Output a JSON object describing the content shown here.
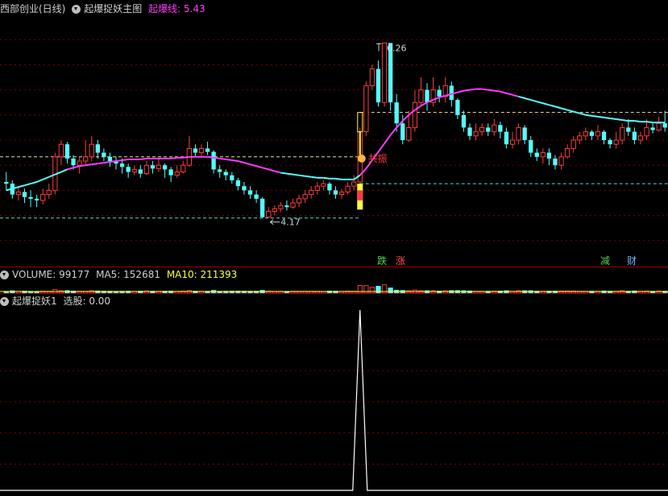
{
  "main": {
    "stock_label": "西部创业(日线)",
    "indicator_label": "起爆捉妖主图",
    "line_label": "起爆线: 5.43",
    "high_label": "6.26",
    "low_label": "4.17",
    "resonance_label": "共振",
    "tags": [
      {
        "text": "跌",
        "color": "#52d152"
      },
      {
        "text": "涨",
        "color": "#ff5050"
      },
      {
        "text": "减",
        "color": "#52d152"
      },
      {
        "text": "财",
        "color": "#6fb6ff"
      }
    ]
  },
  "volume": {
    "label": "VOLUME: 99177",
    "ma5": "MA5: 152681",
    "ma10": "MA10: 211393"
  },
  "signal": {
    "label": "起爆捉妖1",
    "value": "选股: 0.00"
  },
  "colors": {
    "up": "#ff3c3c",
    "down": "#54ffff",
    "ma_line": "#ff3cff",
    "signal": "#ffffff",
    "grid": "#7a0000"
  },
  "chart_data": [
    {
      "type": "candlestick",
      "title": "起爆捉妖主图",
      "ylim": [
        3.6,
        6.6
      ],
      "levels": [
        4.17,
        4.58,
        4.9,
        5.43
      ],
      "high_marker": {
        "index": 62,
        "value": 6.26
      },
      "low_marker": {
        "index": 43,
        "value": 4.17
      },
      "candles": [
        [
          4.6,
          4.58,
          4.72,
          4.5
        ],
        [
          4.58,
          4.45,
          4.62,
          4.4
        ],
        [
          4.45,
          4.48,
          4.55,
          4.38
        ],
        [
          4.48,
          4.42,
          4.52,
          4.35
        ],
        [
          4.42,
          4.4,
          4.5,
          4.3
        ],
        [
          4.4,
          4.38,
          4.45,
          4.3
        ],
        [
          4.38,
          4.45,
          4.52,
          4.33
        ],
        [
          4.45,
          4.5,
          4.58,
          4.4
        ],
        [
          4.5,
          4.9,
          4.95,
          4.45
        ],
        [
          4.9,
          5.05,
          5.1,
          4.8
        ],
        [
          5.05,
          4.88,
          5.08,
          4.82
        ],
        [
          4.88,
          4.8,
          4.92,
          4.75
        ],
        [
          4.8,
          4.85,
          4.9,
          4.7
        ],
        [
          4.85,
          4.9,
          5.1,
          4.8
        ],
        [
          4.9,
          5.05,
          5.15,
          4.85
        ],
        [
          5.05,
          4.95,
          5.1,
          4.88
        ],
        [
          4.95,
          4.9,
          5.0,
          4.85
        ],
        [
          4.9,
          4.85,
          4.95,
          4.78
        ],
        [
          4.85,
          4.82,
          4.9,
          4.75
        ],
        [
          4.82,
          4.78,
          4.88,
          4.7
        ],
        [
          4.78,
          4.72,
          4.82,
          4.65
        ],
        [
          4.72,
          4.75,
          4.8,
          4.68
        ],
        [
          4.75,
          4.7,
          4.8,
          4.65
        ],
        [
          4.7,
          4.8,
          4.85,
          4.68
        ],
        [
          4.8,
          4.76,
          4.85,
          4.7
        ],
        [
          4.76,
          4.8,
          4.88,
          4.72
        ],
        [
          4.8,
          4.75,
          4.82,
          4.65
        ],
        [
          4.75,
          4.68,
          4.78,
          4.6
        ],
        [
          4.68,
          4.72,
          4.8,
          4.65
        ],
        [
          4.72,
          4.8,
          4.85,
          4.7
        ],
        [
          4.8,
          5.0,
          5.15,
          4.78
        ],
        [
          5.0,
          4.95,
          5.05,
          4.9
        ],
        [
          4.95,
          5.0,
          5.05,
          4.9
        ],
        [
          5.0,
          4.96,
          5.08,
          4.92
        ],
        [
          4.96,
          4.75,
          4.98,
          4.7
        ],
        [
          4.75,
          4.72,
          4.8,
          4.65
        ],
        [
          4.72,
          4.68,
          4.75,
          4.62
        ],
        [
          4.68,
          4.62,
          4.72,
          4.58
        ],
        [
          4.62,
          4.55,
          4.65,
          4.5
        ],
        [
          4.55,
          4.5,
          4.6,
          4.45
        ],
        [
          4.5,
          4.45,
          4.55,
          4.4
        ],
        [
          4.45,
          4.4,
          4.5,
          4.35
        ],
        [
          4.4,
          4.18,
          4.42,
          4.17
        ],
        [
          4.18,
          4.25,
          4.3,
          4.17
        ],
        [
          4.25,
          4.28,
          4.32,
          4.2
        ],
        [
          4.28,
          4.32,
          4.36,
          4.24
        ],
        [
          4.32,
          4.3,
          4.38,
          4.26
        ],
        [
          4.3,
          4.35,
          4.4,
          4.28
        ],
        [
          4.35,
          4.4,
          4.45,
          4.3
        ],
        [
          4.4,
          4.45,
          4.5,
          4.35
        ],
        [
          4.45,
          4.5,
          4.55,
          4.4
        ],
        [
          4.5,
          4.55,
          4.6,
          4.45
        ],
        [
          4.55,
          4.58,
          4.62,
          4.5
        ],
        [
          4.58,
          4.5,
          4.6,
          4.45
        ],
        [
          4.5,
          4.45,
          4.55,
          4.4
        ],
        [
          4.45,
          4.48,
          4.52,
          4.4
        ],
        [
          4.48,
          4.55,
          4.6,
          4.45
        ],
        [
          4.55,
          4.6,
          4.68,
          4.5
        ],
        [
          4.6,
          5.2,
          5.25,
          4.58
        ],
        [
          5.2,
          5.75,
          5.8,
          5.15
        ],
        [
          5.75,
          5.95,
          6.0,
          5.7
        ],
        [
          5.95,
          5.55,
          6.05,
          5.5
        ],
        [
          5.55,
          6.26,
          6.26,
          5.5
        ],
        [
          6.26,
          5.55,
          6.1,
          5.45
        ],
        [
          5.55,
          5.3,
          5.65,
          5.2
        ],
        [
          5.3,
          5.1,
          5.4,
          5.05
        ],
        [
          5.1,
          5.25,
          5.45,
          5.08
        ],
        [
          5.25,
          5.55,
          5.7,
          5.2
        ],
        [
          5.55,
          5.7,
          5.85,
          5.5
        ],
        [
          5.7,
          5.55,
          5.78,
          5.45
        ],
        [
          5.55,
          5.7,
          5.85,
          5.5
        ],
        [
          5.7,
          5.62,
          5.75,
          5.55
        ],
        [
          5.62,
          5.75,
          5.85,
          5.55
        ],
        [
          5.75,
          5.58,
          5.8,
          5.5
        ],
        [
          5.58,
          5.4,
          5.6,
          5.35
        ],
        [
          5.4,
          5.25,
          5.45,
          5.2
        ],
        [
          5.25,
          5.15,
          5.3,
          5.1
        ],
        [
          5.15,
          5.2,
          5.3,
          5.1
        ],
        [
          5.2,
          5.25,
          5.3,
          5.15
        ],
        [
          5.25,
          5.2,
          5.3,
          5.15
        ],
        [
          5.2,
          5.28,
          5.35,
          5.15
        ],
        [
          5.28,
          5.2,
          5.32,
          5.12
        ],
        [
          5.2,
          5.05,
          5.25,
          5.0
        ],
        [
          5.05,
          5.1,
          5.2,
          5.0
        ],
        [
          5.1,
          5.25,
          5.3,
          5.05
        ],
        [
          5.25,
          5.1,
          5.28,
          5.05
        ],
        [
          5.1,
          4.95,
          5.15,
          4.9
        ],
        [
          4.95,
          4.9,
          5.0,
          4.85
        ],
        [
          4.9,
          4.95,
          5.0,
          4.82
        ],
        [
          4.95,
          4.88,
          5.0,
          4.8
        ],
        [
          4.88,
          4.8,
          4.92,
          4.75
        ],
        [
          4.8,
          4.9,
          4.95,
          4.75
        ],
        [
          4.9,
          5.0,
          5.05,
          4.88
        ],
        [
          5.0,
          5.1,
          5.15,
          4.95
        ],
        [
          5.1,
          5.15,
          5.2,
          5.05
        ],
        [
          5.15,
          5.2,
          5.25,
          5.1
        ],
        [
          5.2,
          5.15,
          5.22,
          5.1
        ],
        [
          5.15,
          5.2,
          5.28,
          5.1
        ],
        [
          5.2,
          5.1,
          5.22,
          5.05
        ],
        [
          5.1,
          5.05,
          5.12,
          5.0
        ],
        [
          5.05,
          5.1,
          5.2,
          5.0
        ],
        [
          5.1,
          5.25,
          5.3,
          5.05
        ],
        [
          5.25,
          5.2,
          5.35,
          5.15
        ],
        [
          5.2,
          5.1,
          5.25,
          5.05
        ],
        [
          5.1,
          5.15,
          5.2,
          5.05
        ],
        [
          5.15,
          5.25,
          5.35,
          5.1
        ],
        [
          5.25,
          5.22,
          5.3,
          5.18
        ],
        [
          5.22,
          5.3,
          5.38,
          5.2
        ],
        [
          5.3,
          5.25,
          5.45,
          5.2
        ]
      ],
      "ma": [
        4.5,
        4.52,
        4.54,
        4.56,
        4.58,
        4.6,
        4.63,
        4.66,
        4.69,
        4.72,
        4.75,
        4.77,
        4.79,
        4.8,
        4.81,
        4.82,
        4.83,
        4.84,
        4.85,
        4.86,
        4.87,
        4.87,
        4.87,
        4.88,
        4.88,
        4.88,
        4.88,
        4.88,
        4.89,
        4.89,
        4.9,
        4.9,
        4.9,
        4.9,
        4.89,
        4.88,
        4.87,
        4.86,
        4.85,
        4.83,
        4.81,
        4.79,
        4.77,
        4.75,
        4.73,
        4.71,
        4.7,
        4.69,
        4.68,
        4.67,
        4.66,
        4.65,
        4.65,
        4.64,
        4.64,
        4.63,
        4.63,
        4.63,
        4.68,
        4.76,
        4.86,
        4.96,
        5.06,
        5.16,
        5.25,
        5.33,
        5.4,
        5.46,
        5.51,
        5.55,
        5.58,
        5.61,
        5.63,
        5.65,
        5.67,
        5.69,
        5.7,
        5.71,
        5.71,
        5.7,
        5.69,
        5.68,
        5.66,
        5.64,
        5.62,
        5.6,
        5.58,
        5.56,
        5.54,
        5.52,
        5.5,
        5.48,
        5.46,
        5.44,
        5.42,
        5.4,
        5.39,
        5.38,
        5.37,
        5.36,
        5.35,
        5.34,
        5.33,
        5.33,
        5.32,
        5.32,
        5.31,
        5.31,
        5.31
      ]
    },
    {
      "type": "bar",
      "title": "VOLUME",
      "values": [
        99177
      ]
    },
    {
      "type": "line",
      "title": "起爆捉妖1",
      "ylim": [
        0,
        1
      ],
      "spike_index": 58,
      "values_note_free": true
    }
  ]
}
